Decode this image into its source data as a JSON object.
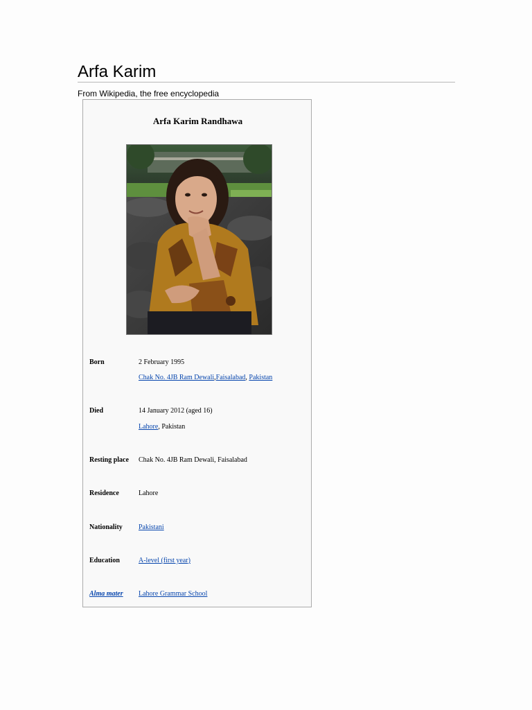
{
  "article": {
    "title": "Arfa Karim",
    "tagline": "From Wikipedia, the free encyclopedia"
  },
  "infobox": {
    "caption": "Arfa Karim Randhawa",
    "portrait_icon": "portrait-photo",
    "rows": {
      "born": {
        "label": "Born",
        "date": "2 February 1995",
        "place_link_1": "Chak No. 4JB Ram Dewali",
        "place_sep_1": ",",
        "place_link_2": "Faisalabad",
        "place_sep_2": ", ",
        "place_link_3": "Pakistan"
      },
      "died": {
        "label": "Died",
        "date": "14 January 2012 (aged 16)",
        "place_link": "Lahore",
        "place_rest": ", Pakistan"
      },
      "resting_place": {
        "label": "Resting place",
        "value": "Chak No. 4JB Ram Dewali, Faisalabad"
      },
      "residence": {
        "label": "Residence",
        "value": "Lahore"
      },
      "nationality": {
        "label": "Nationality",
        "value": "Pakistani"
      },
      "education": {
        "label": "Education",
        "value": "A-level (first year)"
      },
      "alma_mater": {
        "label": "Alma mater",
        "value": "Lahore Grammar School"
      }
    }
  },
  "colors": {
    "link": "#0645ad",
    "infobox_bg": "#f9f9f9",
    "infobox_border": "#aaaaaa"
  }
}
